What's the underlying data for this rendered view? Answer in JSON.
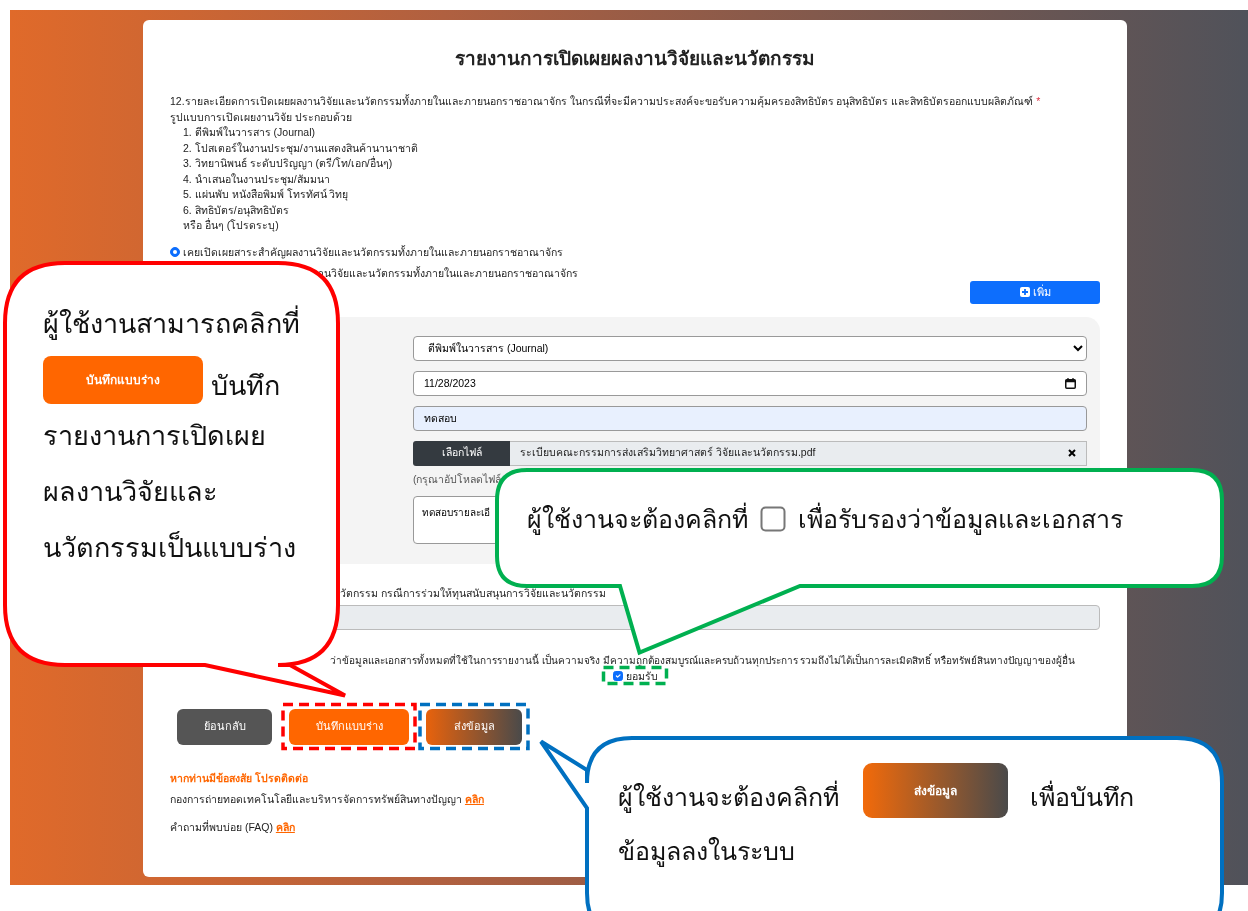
{
  "page": {
    "title": "รายงานการเปิดเผยผลงานวิจัยและนวัตกรรม"
  },
  "question": {
    "text": "12.รายละเอียดการเปิดเผยผลงานวิจัยและนวัตกรรมทั้งภายในและภายนอกราชอาณาจักร ในกรณีที่จะมีความประสงค์จะขอรับความคุ้มครองสิทธิบัตร อนุสิทธิบัตร และสิทธิบัตรออกแบบผลิตภัณฑ์",
    "required_mark": "*"
  },
  "intro": "รูปแบบการเปิดเผยงานวิจัย ประกอบด้วย",
  "formats": [
    "1. ตีพิมพ์ในวารสาร (Journal)",
    "2. โปสเตอร์ในงานประชุม/งานแสดงสินค้านานาชาติ",
    "3. วิทยานิพนธ์ ระดับปริญญา (ตรี/โท/เอก/อื่นๆ)",
    "4. นำเสนอในงานประชุม/สัมมนา",
    "5. แผ่นพับ หนังสือพิมพ์ โทรทัศน์ วิทยุ",
    "6. สิทธิบัตร/อนุสิทธิบัตร",
    "หรือ อื่นๆ (โปรดระบุ)"
  ],
  "disclosure_option": {
    "label": "เคยเปิดเผยสาระสำคัญผลงานวิจัยและนวัตกรรมทั้งภายในและภายนอกราชอาณาจักร",
    "selected": true
  },
  "partial_option_text": "านวิจัยและนวัตกรรมทั้งภายในและภายนอกราชอาณาจักร",
  "add_button": {
    "label": "เพิ่ม"
  },
  "entry": {
    "type_select": "ตีพิมพ์ในวารสาร (Journal)",
    "date": "11/28/2023",
    "title_value": "ทดสอบ",
    "file_button": "เลือกไฟล์",
    "file_name": "ระเบียบคณะกรรมการส่งเสริมวิทยาศาสตร์ วิจัยและนวัตกรรม.pdf",
    "help_text": "(กรุณาอัปโหลดไฟล์",
    "details_value": "ทดสอบรายละเอี"
  },
  "funding": {
    "label": "วัตกรรม กรณีการร่วมให้ทุนสนับสนุนการวิจัยและนวัตกรรม"
  },
  "declaration": {
    "text": "ว่าข้อมูลและเอกสารทั้งหมดที่ใช้ในการรายงานนี้ เป็นความจริง มีความถูกต้องสมบูรณ์และครบถ้วนทุกประการ รวมถึงไม่ได้เป็นการละเมิดสิทธิ์ หรือทรัพย์สินทางปัญญาของผู้อื่น",
    "accept_label": "ยอมรับ",
    "checked": true
  },
  "buttons": [
    {
      "label": "ย้อนกลับ",
      "kind": "back"
    },
    {
      "label": "บันทึกแบบร่าง",
      "kind": "draft"
    },
    {
      "label": "ส่งข้อมูล",
      "kind": "submit"
    }
  ],
  "contact": {
    "heading": "หากท่านมีข้อสงสัย โปรดติดต่อ",
    "lines": [
      {
        "text": "กองการถ่ายทอดเทคโนโลยีและบริหารจัดการทรัพย์สินทางปัญญา",
        "link": "คลิก"
      },
      {
        "text": "คำถามที่พบบ่อย (FAQ)",
        "link": "คลิก"
      }
    ]
  },
  "callouts": [
    {
      "kind": "draft",
      "color": "#ff0000",
      "text_before": "ผู้ใช้งานสามารถคลิกที่",
      "button_label": "บันทึกแบบร่าง",
      "text_after": "บันทึก",
      "text_rest": "รายงานการเปิดเผยผลงานวิจัยและนวัตกรรมเป็นแบบร่าง"
    },
    {
      "kind": "accept",
      "color": "#00b050",
      "text_before": "ผู้ใช้งานจะต้องคลิกที่",
      "text_after": "เพื่อรับรองว่าข้อมูลและเอกสาร"
    },
    {
      "kind": "submit",
      "color": "#0070c0",
      "text_before": "ผู้ใช้งานจะต้องคลิกที่",
      "button_label": "ส่งข้อมูล",
      "text_after": "เพื่อบันทึก",
      "text_rest": "ข้อมูลลงในระบบ"
    }
  ]
}
